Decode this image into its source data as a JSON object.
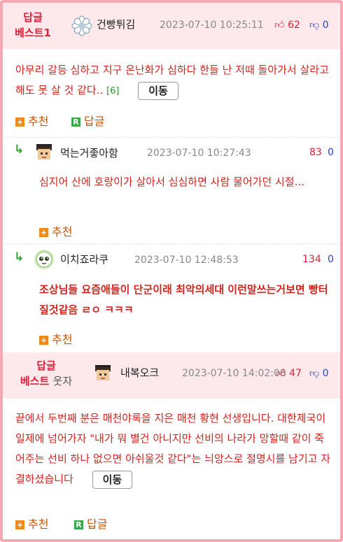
{
  "best1": {
    "badge_line1": "답글",
    "badge_line2": "베스트1",
    "nick": "건빵튀김",
    "date": "2023-07-10 10:25:11",
    "up": "62",
    "down": "0",
    "body": "아무리 갈등 심하고 지구 온난화가 심하다 한들 난 저때 돌아가서 살라고 해도 못 살 것 같다..",
    "reply_count": "[6]",
    "move_label": "이동",
    "recommend_label": "추천",
    "reply_label": "답글"
  },
  "replies": [
    {
      "nick": "먹는거좋아함",
      "date": "2023-07-10 10:27:43",
      "up": "83",
      "down": "0",
      "body": "심지어 산에 호랑이가 살아서 심심하면 사람 물어가던 시절...",
      "recommend_label": "추천"
    },
    {
      "nick": "이치죠라쿠",
      "date": "2023-07-10 12:48:53",
      "up": "134",
      "down": "0",
      "body": "조상님들 요즘애들이 단군이래 최악의세대 이런말쓰는거보면 빵터질것같음 ㄹㅇ ㅋㅋㅋ",
      "recommend_label": "추천"
    }
  ],
  "best2": {
    "badge_line1": "답글",
    "badge_line2": "베스트",
    "badge_extra": "웃자",
    "nick": "내복오크",
    "date": "2023-07-10 14:02:08",
    "up": "47",
    "down": "0",
    "body": "끝에서 두번째 분은 매천야록을 지은 매천 황현 선생입니다. 대한제국이 일제에 넘어가자 \"내가 뭐 별건 아니지만 선비의 나라가 망할때 같이 죽어주는 선비 하나 없으면 아쉬울것 같다\"는 늬앙스로 절명시를 남기고 자결하셨습니다",
    "move_label": "이동",
    "recommend_label": "추천",
    "reply_label": "답글"
  },
  "icons": {
    "reply_arrow": "↳",
    "recommend_box": "+",
    "reply_box": "R"
  },
  "colors": {
    "accent_red": "#e0203a",
    "body_red": "#d0251f",
    "down_blue": "#2a43c8",
    "header_pink": "#fde9ec",
    "border_pink": "#f7a9b3"
  }
}
